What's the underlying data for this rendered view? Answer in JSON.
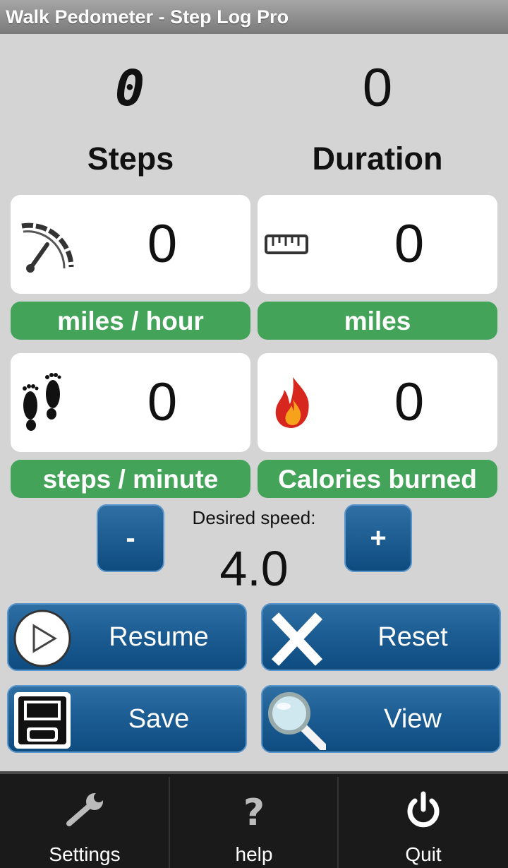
{
  "app": {
    "title": "Walk Pedometer - Step Log Pro"
  },
  "counters": {
    "steps_value": "0",
    "steps_label": "Steps",
    "duration_value": "0",
    "duration_label": "Duration"
  },
  "stats": {
    "speed": {
      "value": "0",
      "unit": "miles / hour",
      "icon": "speedometer-icon"
    },
    "distance": {
      "value": "0",
      "unit": "miles",
      "icon": "ruler-icon"
    },
    "cadence": {
      "value": "0",
      "unit": "steps / minute",
      "icon": "footprints-icon"
    },
    "calories": {
      "value": "0",
      "unit": "Calories burned",
      "icon": "flame-icon"
    }
  },
  "desired_speed": {
    "label": "Desired speed:",
    "value": "4.0",
    "decrease_label": "-",
    "increase_label": "+"
  },
  "actions": {
    "resume_label": "Resume",
    "reset_label": "Reset",
    "save_label": "Save",
    "view_label": "View"
  },
  "bottom_nav": {
    "settings_label": "Settings",
    "help_label": "help",
    "quit_label": "Quit"
  },
  "colors": {
    "accent_green": "#43a459",
    "button_blue": "#1c5d93",
    "background": "#d4d4d4"
  }
}
